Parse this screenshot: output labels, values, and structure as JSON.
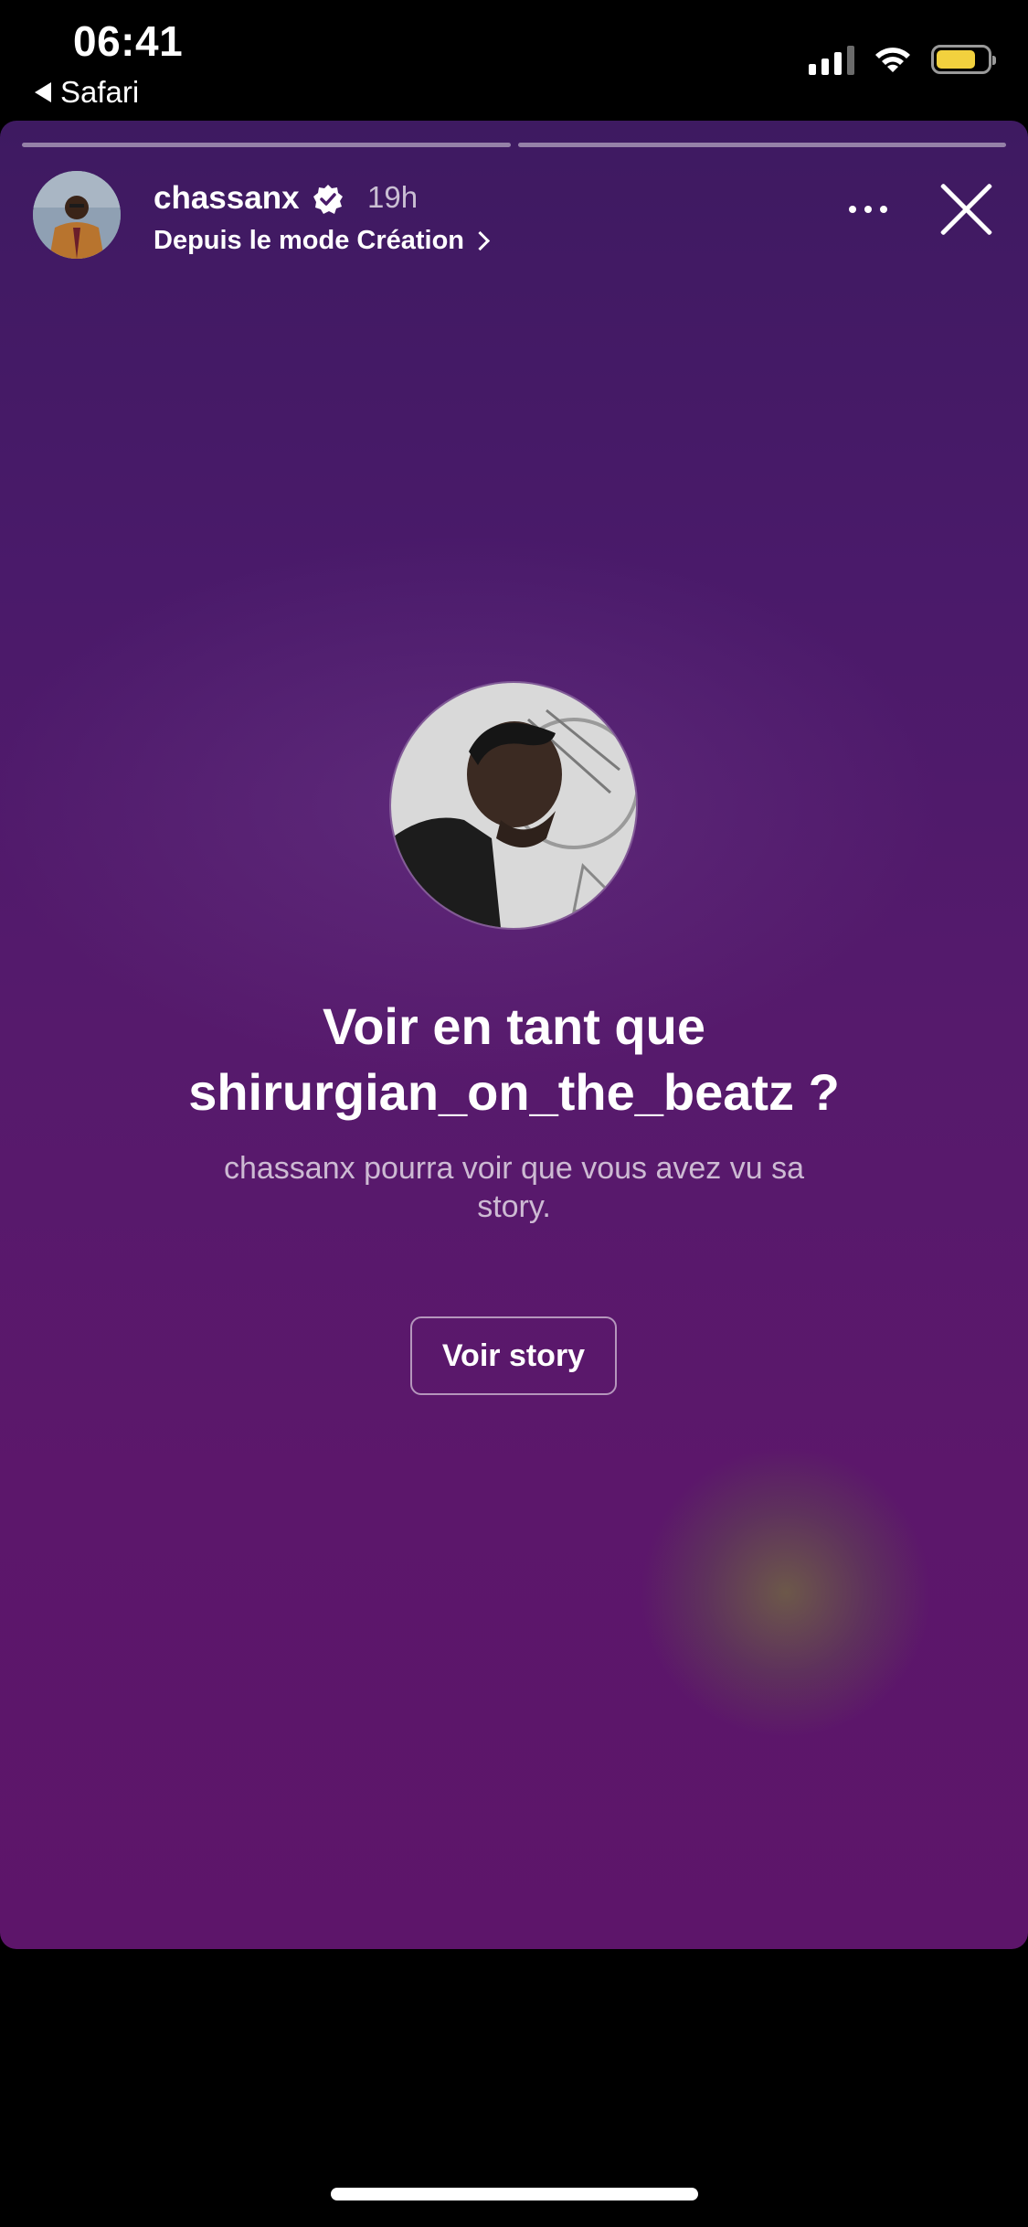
{
  "status_bar": {
    "time": "06:41",
    "back_label": "Safari",
    "icons": [
      "signal-icon",
      "wifi-icon",
      "battery-icon"
    ],
    "battery_level": 0.78,
    "battery_color": "#f2d13e"
  },
  "story": {
    "progress_segments": 2,
    "username": "chassanx",
    "time_ago": "19h",
    "subtitle": "Depuis le mode Création",
    "headline_line1": "Voir en tant que",
    "headline_line2": "shirurgian_on_the_beatz ?",
    "description": "chassanx pourra voir que vous avez vu sa story.",
    "button_label": "Voir story",
    "background_colors": [
      "#3e1a61",
      "#5d156a"
    ]
  }
}
